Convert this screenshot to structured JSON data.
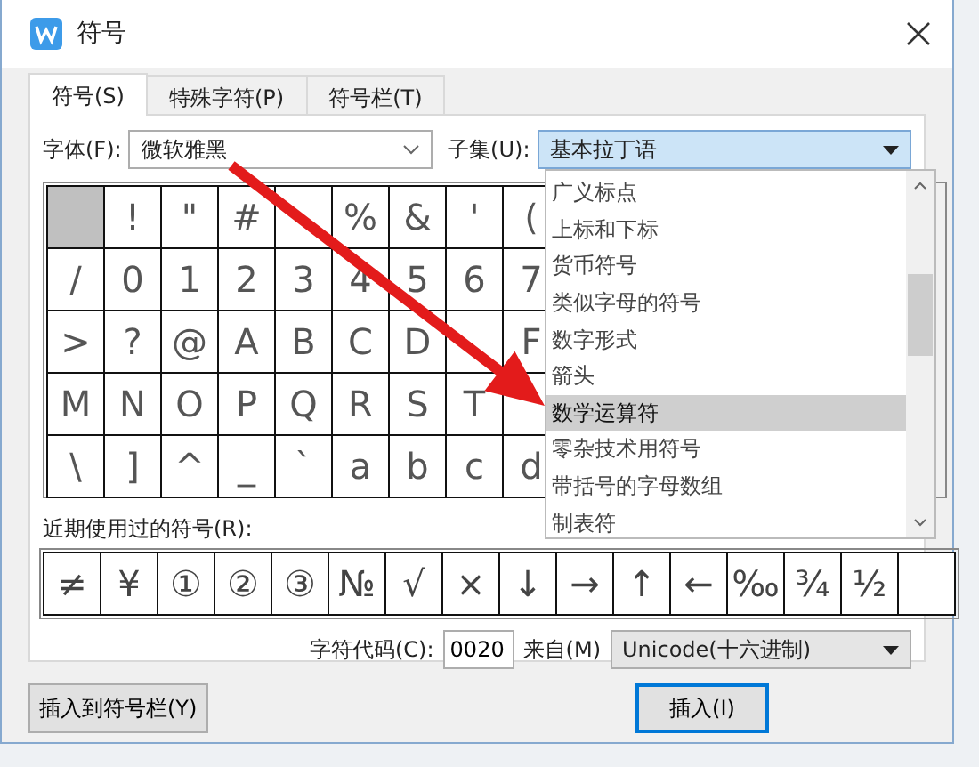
{
  "window": {
    "title": "符号"
  },
  "tabs": [
    {
      "label": "符号(S)",
      "selected": true
    },
    {
      "label": "特殊字符(P)",
      "selected": false
    },
    {
      "label": "符号栏(T)",
      "selected": false
    }
  ],
  "font_field": {
    "label": "字体(F):",
    "value": "微软雅黑"
  },
  "subset_field": {
    "label": "子集(U):",
    "value": "基本拉丁语"
  },
  "symbol_grid": [
    [
      {
        "selected": true
      },
      {
        "char": "!",
        "selected": false
      },
      {
        "char": "\"",
        "selected": false
      },
      {
        "char": "#",
        "selected": false
      },
      {
        "selected": false
      },
      {
        "char": "%",
        "selected": false
      },
      {
        "char": "&",
        "selected": false
      },
      {
        "char": "'",
        "selected": false
      },
      {
        "char": "(",
        "selected": false
      }
    ],
    [
      {
        "char": "/",
        "selected": false
      },
      {
        "char": "0",
        "selected": false
      },
      {
        "char": "1",
        "selected": false
      },
      {
        "char": "2",
        "selected": false
      },
      {
        "char": "3",
        "selected": false
      },
      {
        "char": "4",
        "selected": false
      },
      {
        "char": "5",
        "selected": false
      },
      {
        "char": "6",
        "selected": false
      },
      {
        "char": "7",
        "selected": false
      }
    ],
    [
      {
        "char": ">",
        "selected": false
      },
      {
        "char": "?",
        "selected": false
      },
      {
        "char": "@",
        "selected": false
      },
      {
        "char": "A",
        "selected": false
      },
      {
        "char": "B",
        "selected": false
      },
      {
        "char": "C",
        "selected": false
      },
      {
        "char": "D",
        "selected": false
      },
      {
        "selected": false
      },
      {
        "char": "F",
        "selected": false
      }
    ],
    [
      {
        "char": "M",
        "selected": false
      },
      {
        "char": "N",
        "selected": false
      },
      {
        "char": "O",
        "selected": false
      },
      {
        "char": "P",
        "selected": false
      },
      {
        "char": "Q",
        "selected": false
      },
      {
        "char": "R",
        "selected": false
      },
      {
        "char": "S",
        "selected": false
      },
      {
        "char": "T",
        "selected": false
      },
      {
        "selected": false
      }
    ],
    [
      {
        "char": "\\",
        "selected": false
      },
      {
        "char": "]",
        "selected": false
      },
      {
        "char": "^",
        "selected": false
      },
      {
        "char": "_",
        "selected": false
      },
      {
        "char": "`",
        "selected": false
      },
      {
        "char": "a",
        "selected": false
      },
      {
        "char": "b",
        "selected": false
      },
      {
        "char": "c",
        "selected": false
      },
      {
        "char": "d",
        "selected": false
      }
    ]
  ],
  "subset_list": [
    {
      "label": "广义标点",
      "selected": false
    },
    {
      "label": "上标和下标",
      "selected": false
    },
    {
      "label": "货币符号",
      "selected": false
    },
    {
      "label": "类似字母的符号",
      "selected": false
    },
    {
      "label": "数字形式",
      "selected": false
    },
    {
      "label": "箭头",
      "selected": false
    },
    {
      "label": "数学运算符",
      "selected": true
    },
    {
      "label": "零杂技术用符号",
      "selected": false
    },
    {
      "label": "带括号的字母数组",
      "selected": false
    },
    {
      "label": "制表符",
      "selected": false
    }
  ],
  "recent_label": "近期使用过的符号(R):",
  "recent_symbols": [
    "≠",
    "¥",
    "①",
    "②",
    "③",
    "№",
    "√",
    "×",
    "↓",
    "→",
    "↑",
    "←",
    "‰",
    "¾",
    "½"
  ],
  "char_code": {
    "label": "字符代码(C):",
    "value": "0020"
  },
  "from_field": {
    "label": "来自(M)",
    "value": "Unicode(十六进制)"
  },
  "buttons": [
    {
      "label": "插入到符号栏(Y)",
      "default": false
    },
    {
      "label": "插入(I)",
      "default": true
    }
  ]
}
